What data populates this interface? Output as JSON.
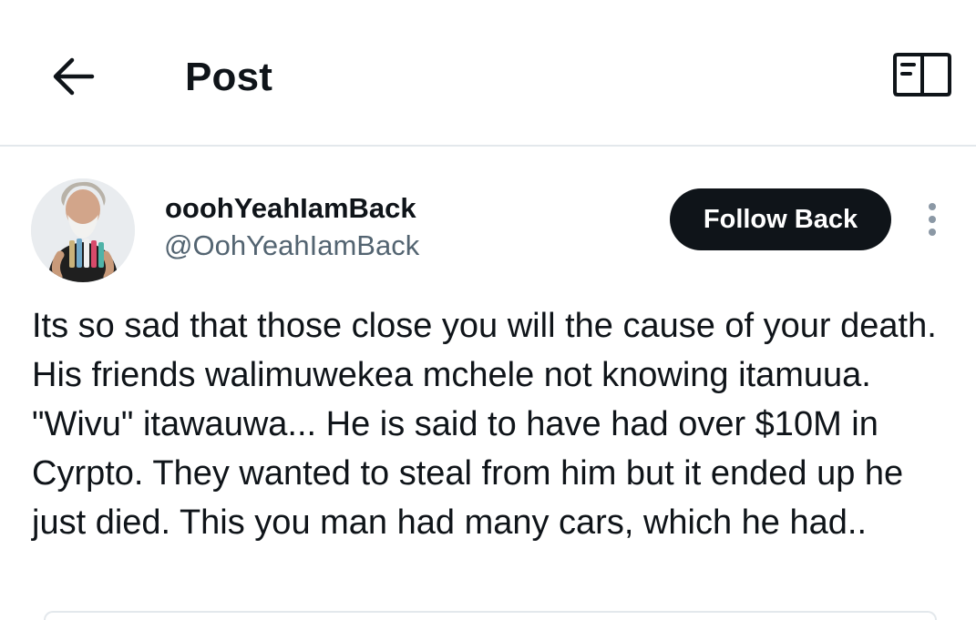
{
  "header": {
    "title": "Post",
    "back_icon": "arrow-left-icon",
    "reader_icon": "reader-mode-icon"
  },
  "post": {
    "author": {
      "display_name": "ooohYeahIamBack",
      "handle": "@OohYeahIamBack"
    },
    "follow_label": "Follow Back",
    "more_icon": "more-vertical-icon",
    "text": "Its so sad that those close you will the cause of your death. His friends walimuwekea mchele not knowing itamuua. \"Wivu\" itawauwa... He is said to have had over $10M in Cyrpto. They wanted to steal from him but it ended up he just died. This you man had many cars, which he had.."
  },
  "colors": {
    "text_primary": "#0f1419",
    "text_secondary": "#536471",
    "button_bg": "#0f1419",
    "divider": "#e3e8ec"
  }
}
